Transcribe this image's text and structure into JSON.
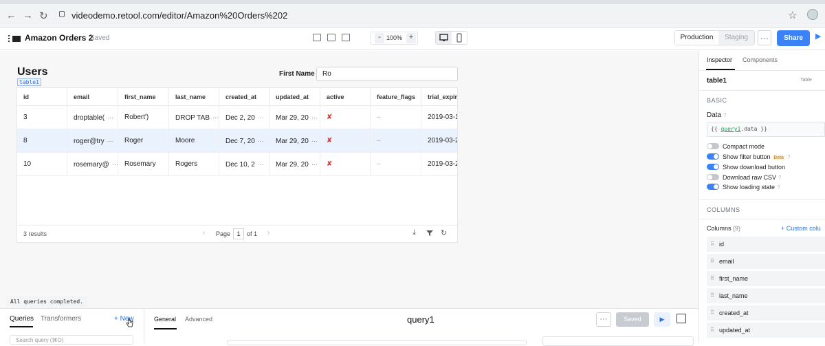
{
  "browser": {
    "url": "videodemo.retool.com/editor/Amazon%20Orders%202"
  },
  "header": {
    "app_title": "Amazon Orders 2",
    "save_status": "Saved",
    "zoom_minus": "-",
    "zoom_value": "100%",
    "zoom_plus": "+",
    "env_production": "Production",
    "env_staging": "Staging",
    "more": "···",
    "share": "Share"
  },
  "canvas": {
    "title": "Users",
    "component_tag": "table1",
    "filter_label": "First Name",
    "filter_value": "Ro",
    "table": {
      "columns": [
        "id",
        "email",
        "first_name",
        "last_name",
        "created_at",
        "updated_at",
        "active",
        "feature_flags",
        "trial_expiry_"
      ],
      "rows": [
        {
          "id": "3",
          "email": "droptable(",
          "first_name": "Robert')",
          "last_name": "DROP TAB",
          "created_at": "Dec 2, 20",
          "updated_at": "Mar 29, 20",
          "active": "✘",
          "feature_flags": "–",
          "trial_expiry": "2019-03-1"
        },
        {
          "id": "8",
          "email": "roger@try",
          "first_name": "Roger",
          "last_name": "Moore",
          "created_at": "Dec 7, 20",
          "updated_at": "Mar 29, 20",
          "active": "✘",
          "feature_flags": "–",
          "trial_expiry": "2019-03-2"
        },
        {
          "id": "10",
          "email": "rosemary@",
          "first_name": "Rosemary",
          "last_name": "Rogers",
          "created_at": "Dec 10, 2",
          "updated_at": "Mar 29, 20",
          "active": "✘",
          "feature_flags": "–",
          "trial_expiry": "2019-03-2"
        }
      ],
      "results": "3 results",
      "page_label": "Page",
      "page_value": "1",
      "page_of": "of 1"
    }
  },
  "inspector": {
    "tabs": [
      "Inspector",
      "Components"
    ],
    "component_name": "table1",
    "component_type": "Table",
    "basic_header": "BASIC",
    "data_label": "Data",
    "data_open": "{{ ",
    "data_query": "query1",
    "data_close": ".data }}",
    "toggles": [
      {
        "label": "Compact mode",
        "on": false
      },
      {
        "label": "Show filter button",
        "on": true,
        "badge": "Beta"
      },
      {
        "label": "Show download button",
        "on": true
      },
      {
        "label": "Download raw CSV",
        "on": false
      },
      {
        "label": "Show loading state",
        "on": true
      }
    ],
    "columns_header": "COLUMNS",
    "columns_label": "Columns",
    "columns_count": "(9)",
    "add_column": "+ Custom colu",
    "column_list": [
      "id",
      "email",
      "first_name",
      "last_name",
      "created_at",
      "updated_at"
    ]
  },
  "bottom": {
    "status": "All queries completed.",
    "tabs": [
      "Queries",
      "Transformers"
    ],
    "new_label": "+ New",
    "search_placeholder": "Search query (⌘O)",
    "editor_tabs": [
      "General",
      "Advanced"
    ],
    "query_name": "query1",
    "saved_label": "Saved"
  },
  "colors": {
    "accent": "#3b82f6",
    "toggle_on": "#3b82f6",
    "toggle_off": "#c4c7cc",
    "selected_row": "#eaf2fe"
  }
}
